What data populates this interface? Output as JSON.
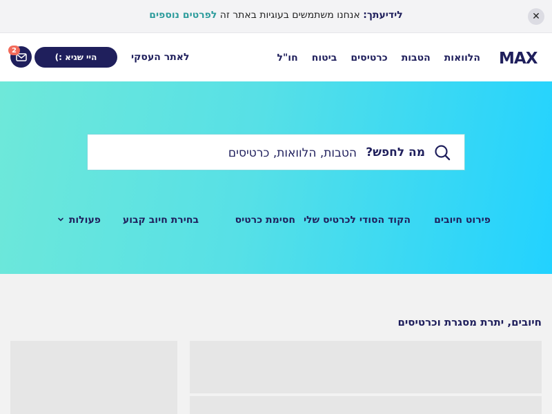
{
  "cookie_bar": {
    "lead": "לידיעתך:",
    "text": " אנחנו משתמשים בעוגיות באתר זה ",
    "link": "לפרטים נוספים",
    "close_symbol": "✕"
  },
  "header": {
    "logo": "MAX",
    "nav": [
      "הלוואות",
      "הטבות",
      "כרטיסים",
      "ביטוח",
      "חו\"ל"
    ],
    "business_link": "לאתר העסקי",
    "user_button": "היי שגיא :)",
    "mail_badge_count": "2"
  },
  "hero": {
    "search_label": "מה לחפש?",
    "search_placeholder": "הטבות, הלוואות, כרטיסים",
    "quick_actions": [
      "פירוט חיובים",
      "הקוד הסודי לכרטיס שלי",
      "חסימת כרטיס",
      "בחירת חיוב קבוע",
      "פעולות"
    ]
  },
  "main": {
    "section_title": "חיובים, יתרת מסגרת וכרטיסים"
  },
  "colors": {
    "brand": "#1f1f5c",
    "accent_link": "#2d9c9c",
    "badge": "#f26b5b",
    "hero_start": "#6ee8d9",
    "hero_end": "#22d2ff"
  }
}
